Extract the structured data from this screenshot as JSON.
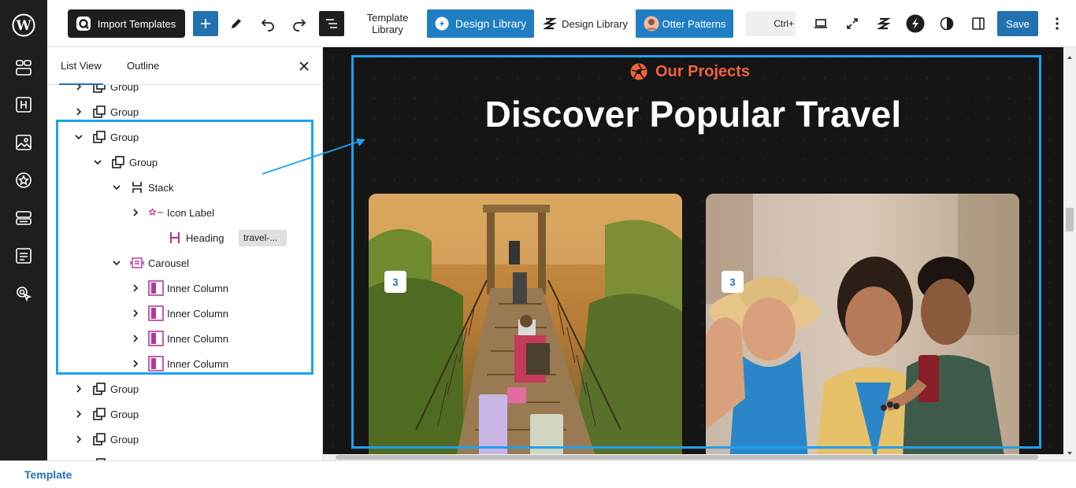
{
  "toolbar": {
    "import_templates": "Import Templates",
    "template_library_line1": "Template",
    "template_library_line2": "Library",
    "design_library_primary": "Design Library",
    "design_library_secondary": "Design Library",
    "otter_patterns": "Otter Patterns",
    "search_shortcut": "Ctrl+",
    "save": "Save"
  },
  "panel": {
    "tabs": [
      {
        "label": "List View",
        "active": true
      },
      {
        "label": "Outline",
        "active": false
      }
    ],
    "tree": [
      {
        "label": "Group"
      },
      {
        "label": "Group"
      },
      {
        "label": "Group"
      },
      {
        "label": "Group"
      },
      {
        "label": "Stack"
      },
      {
        "label": "Icon Label"
      },
      {
        "label": "Heading",
        "tag": "travel-..."
      },
      {
        "label": "Carousel"
      },
      {
        "label": "Inner Column"
      },
      {
        "label": "Inner Column"
      },
      {
        "label": "Inner Column"
      },
      {
        "label": "Inner Column"
      },
      {
        "label": "Group"
      },
      {
        "label": "Group"
      },
      {
        "label": "Group"
      },
      {
        "label": "Group"
      }
    ]
  },
  "canvas": {
    "eyebrow": "Our Projects",
    "title": "Discover Popular Travel",
    "cards": [
      {
        "badge": "3"
      },
      {
        "badge": "3"
      }
    ]
  },
  "footer": {
    "breadcrumb": "Template"
  },
  "colors": {
    "accent": "#2271b1",
    "highlight": "#1ea1f1",
    "eyebrow": "#f0633c",
    "canvas_bg": "#151515"
  }
}
